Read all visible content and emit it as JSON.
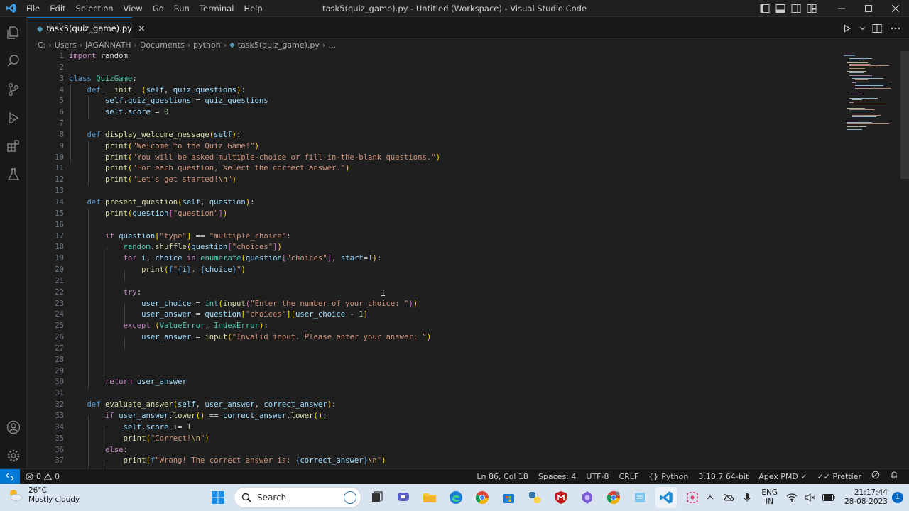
{
  "titlebar": {
    "menu": [
      "File",
      "Edit",
      "Selection",
      "View",
      "Go",
      "Run",
      "Terminal",
      "Help"
    ],
    "title": "task5(quiz_game).py - Untitled (Workspace) - Visual Studio Code"
  },
  "tab": {
    "label": "task5(quiz_game).py",
    "close": "×"
  },
  "breadcrumb": [
    "C:",
    "Users",
    "JAGANNATH",
    "Documents",
    "python",
    "task5(quiz_game).py",
    "..."
  ],
  "editor": {
    "line_numbers": [
      "1",
      "2",
      "3",
      "4",
      "5",
      "6",
      "7",
      "8",
      "9",
      "10",
      "11",
      "12",
      "13",
      "14",
      "15",
      "16",
      "17",
      "18",
      "19",
      "20",
      "21",
      "22",
      "23",
      "24",
      "25",
      "26",
      "27",
      "28",
      "29",
      "30",
      "31",
      "32",
      "33",
      "34",
      "35",
      "36",
      "37"
    ],
    "code": {
      "l1": "import random",
      "l3": "class QuizGame:",
      "l4": "    def __init__(self, quiz_questions):",
      "l5": "        self.quiz_questions = quiz_questions",
      "l6": "        self.score = 0",
      "l8": "    def display_welcome_message(self):",
      "l9": "        print(\"Welcome to the Quiz Game!\")",
      "l10": "        print(\"You will be asked multiple-choice or fill-in-the-blank questions.\")",
      "l11": "        print(\"For each question, select the correct answer.\")",
      "l12": "        print(\"Let's get started!\\n\")",
      "l14": "    def present_question(self, question):",
      "l15": "        print(question[\"question\"])",
      "l17": "        if question[\"type\"] == \"multiple_choice\":",
      "l18": "            random.shuffle(question[\"choices\"])",
      "l19": "            for i, choice in enumerate(question[\"choices\"], start=1):",
      "l20": "                print(f\"{i}. {choice}\")",
      "l22": "            try:",
      "l23": "                user_choice = int(input(\"Enter the number of your choice: \"))",
      "l24": "                user_answer = question[\"choices\"][user_choice - 1]",
      "l25": "            except (ValueError, IndexError):",
      "l26": "                user_answer = input(\"Invalid input. Please enter your answer: \")",
      "l30": "        return user_answer",
      "l32": "    def evaluate_answer(self, user_answer, correct_answer):",
      "l33": "        if user_answer.lower() == correct_answer.lower():",
      "l34": "            self.score += 1",
      "l35": "            print(\"Correct!\\n\")",
      "l36": "        else:",
      "l37": "            print(f\"Wrong! The correct answer is: {correct_answer}\\n\")"
    }
  },
  "statusbar": {
    "problems": "0",
    "warnings": "0",
    "position": "Ln 86, Col 18",
    "spaces": "Spaces: 4",
    "encoding": "UTF-8",
    "eol": "CRLF",
    "language": "Python",
    "interpreter": "3.10.7 64-bit",
    "pmd": "Apex PMD",
    "prettier": "Prettier"
  },
  "taskbar": {
    "weather_temp": "26°C",
    "weather_desc": "Mostly cloudy",
    "search_label": "Search",
    "lang_top": "ENG",
    "lang_bottom": "IN",
    "time": "21:17:44",
    "date": "28-08-2023",
    "notification_count": "1"
  },
  "colors": {
    "accent": "#0078d4",
    "editor_bg": "#1f1f1f",
    "taskbar_bg": "#d9e4f1"
  }
}
